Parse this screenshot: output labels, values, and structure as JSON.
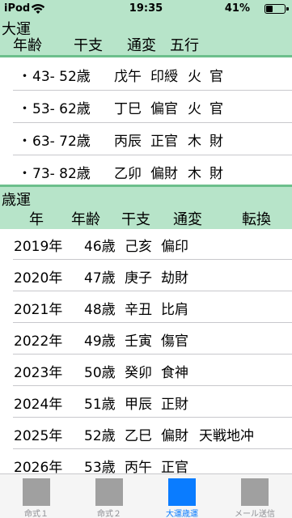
{
  "status_bar": {
    "carrier": "iPod",
    "time": "19:35",
    "battery_percent": "41%",
    "battery_level": 0.41
  },
  "daiun": {
    "title": "大運",
    "headers": [
      "年齢",
      "干支",
      "通変",
      "五行"
    ],
    "rows": [
      {
        "bullet": "・",
        "age": "43- 52歳",
        "kanshi": "戊午",
        "tsuhen": "印綬",
        "gogyo1": "火",
        "gogyo2": "官"
      },
      {
        "bullet": "・",
        "age": "53- 62歳",
        "kanshi": "丁巳",
        "tsuhen": "偏官",
        "gogyo1": "火",
        "gogyo2": "官"
      },
      {
        "bullet": "・",
        "age": "63- 72歳",
        "kanshi": "丙辰",
        "tsuhen": "正官",
        "gogyo1": "木",
        "gogyo2": "財"
      },
      {
        "bullet": "・",
        "age": "73- 82歳",
        "kanshi": "乙卯",
        "tsuhen": "偏財",
        "gogyo1": "木",
        "gogyo2": "財"
      }
    ]
  },
  "saiun": {
    "title": "歳運",
    "headers": [
      "年",
      "年齢",
      "干支",
      "通変",
      "転換"
    ],
    "rows": [
      {
        "year": "2019年",
        "age": "46歳",
        "kanshi": "己亥",
        "tsuhen": "偏印",
        "tenkan": ""
      },
      {
        "year": "2020年",
        "age": "47歳",
        "kanshi": "庚子",
        "tsuhen": "劫財",
        "tenkan": ""
      },
      {
        "year": "2021年",
        "age": "48歳",
        "kanshi": "辛丑",
        "tsuhen": "比肩",
        "tenkan": ""
      },
      {
        "year": "2022年",
        "age": "49歳",
        "kanshi": "壬寅",
        "tsuhen": "傷官",
        "tenkan": ""
      },
      {
        "year": "2023年",
        "age": "50歳",
        "kanshi": "癸卯",
        "tsuhen": "食神",
        "tenkan": ""
      },
      {
        "year": "2024年",
        "age": "51歳",
        "kanshi": "甲辰",
        "tsuhen": "正財",
        "tenkan": ""
      },
      {
        "year": "2025年",
        "age": "52歳",
        "kanshi": "乙巳",
        "tsuhen": "偏財",
        "tenkan": "天戦地冲"
      },
      {
        "year": "2026年",
        "age": "53歳",
        "kanshi": "丙午",
        "tsuhen": "正官",
        "tenkan": ""
      }
    ]
  },
  "tab_bar": {
    "tabs": [
      {
        "label": "命式１",
        "active": false
      },
      {
        "label": "命式２",
        "active": false
      },
      {
        "label": "大運歳運",
        "active": true
      },
      {
        "label": "メール送信",
        "active": false
      }
    ]
  },
  "colors": {
    "header_bg": "#b7e4c9",
    "header_rule": "#6cbf8c",
    "active_tab": "#0a7cff",
    "inactive_tab_icon": "#a0a0a0"
  }
}
